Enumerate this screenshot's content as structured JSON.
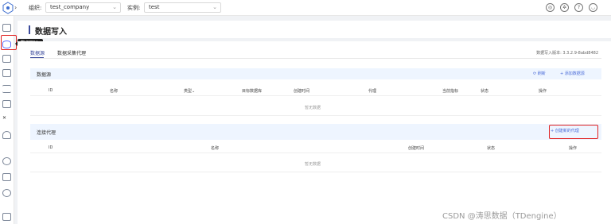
{
  "topbar": {
    "org_label": "组织:",
    "org_value": "test_company",
    "instance_label": "实例:",
    "instance_value": "test"
  },
  "sidebar": {
    "tooltip": "数据写入"
  },
  "page": {
    "title": "数据写入"
  },
  "tabs": [
    {
      "label": "数据源"
    },
    {
      "label": "数据采集代理"
    }
  ],
  "version": "数据写入版本: 3.3.2.9-8abd8482",
  "datasource": {
    "title": "数据源",
    "refresh": "刷新",
    "add": "添加数据源",
    "columns": [
      "ID",
      "名称",
      "类型",
      "目标数据库",
      "创建时间",
      "代理",
      "当前指标",
      "状态",
      "操作"
    ],
    "empty": "暂无数据"
  },
  "agents": {
    "title": "连接代理",
    "create": "创建新的代理",
    "columns": [
      "ID",
      "名称",
      "创建时间",
      "状态",
      "操作"
    ],
    "empty": "暂无数据"
  },
  "watermark": "CSDN @涛思数据（TDengine）"
}
